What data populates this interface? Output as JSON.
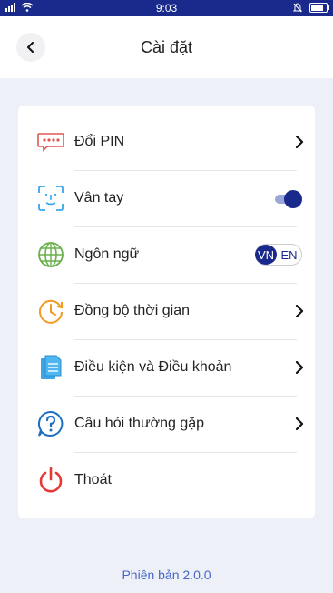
{
  "status": {
    "time": "9:03"
  },
  "header": {
    "title": "Cài đặt"
  },
  "settings": {
    "items": [
      {
        "label": "Đổi PIN",
        "icon": "pin-dots-icon"
      },
      {
        "label": "Vân tay",
        "icon": "face-id-icon",
        "toggle_on": true
      },
      {
        "label": "Ngôn ngữ",
        "icon": "globe-icon",
        "lang_selected": "VN",
        "lang_options": [
          "VN",
          "EN"
        ]
      },
      {
        "label": "Đồng bộ thời gian",
        "icon": "clock-sync-icon"
      },
      {
        "label": "Điều kiện và Điều khoản",
        "icon": "document-icon"
      },
      {
        "label": "Câu hỏi thường gặp",
        "icon": "question-icon"
      },
      {
        "label": "Thoát",
        "icon": "power-icon"
      }
    ]
  },
  "footer": {
    "version": "Phiên bản 2.0.0"
  },
  "colors": {
    "primary": "#1a2a8c",
    "accent_link": "#4866c8",
    "background": "#eef0f7"
  }
}
